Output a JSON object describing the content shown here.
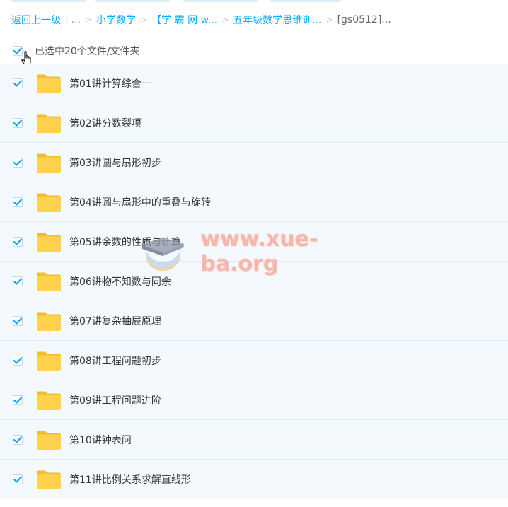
{
  "breadcrumb": {
    "back_label": "返回上一级",
    "ellipsis": "...",
    "items": [
      "小学数学",
      "【学 霸 网 w...",
      "五年级数学思维训..."
    ],
    "current": "[gs0512]..."
  },
  "selection": {
    "label": "已选中20个文件/文件夹",
    "selected_count": 20,
    "all_checked": true
  },
  "files": [
    {
      "name": "第01讲计算综合一",
      "checked": true,
      "type": "folder"
    },
    {
      "name": "第02讲分数裂项",
      "checked": true,
      "type": "folder"
    },
    {
      "name": "第03讲圆与扇形初步",
      "checked": true,
      "type": "folder"
    },
    {
      "name": "第04讲圆与扇形中的重叠与旋转",
      "checked": true,
      "type": "folder"
    },
    {
      "name": "第05讲余数的性质与计算",
      "checked": true,
      "type": "folder"
    },
    {
      "name": "第06讲物不知数与同余",
      "checked": true,
      "type": "folder"
    },
    {
      "name": "第07讲复杂抽屉原理",
      "checked": true,
      "type": "folder"
    },
    {
      "name": "第08讲工程问题初步",
      "checked": true,
      "type": "folder"
    },
    {
      "name": "第09讲工程问题进阶",
      "checked": true,
      "type": "folder"
    },
    {
      "name": "第10讲钟表问",
      "checked": true,
      "type": "folder"
    },
    {
      "name": "第11讲比例关系求解直线形",
      "checked": true,
      "type": "folder"
    }
  ],
  "watermark": {
    "text": "www.xue-ba.org",
    "icon": "graduation-cap-icon"
  },
  "colors": {
    "link": "#09aaff",
    "check": "#09aaff",
    "row_bg": "#f3f9fd",
    "folder": "#ffd24d",
    "watermark": "#f4b0a6"
  }
}
